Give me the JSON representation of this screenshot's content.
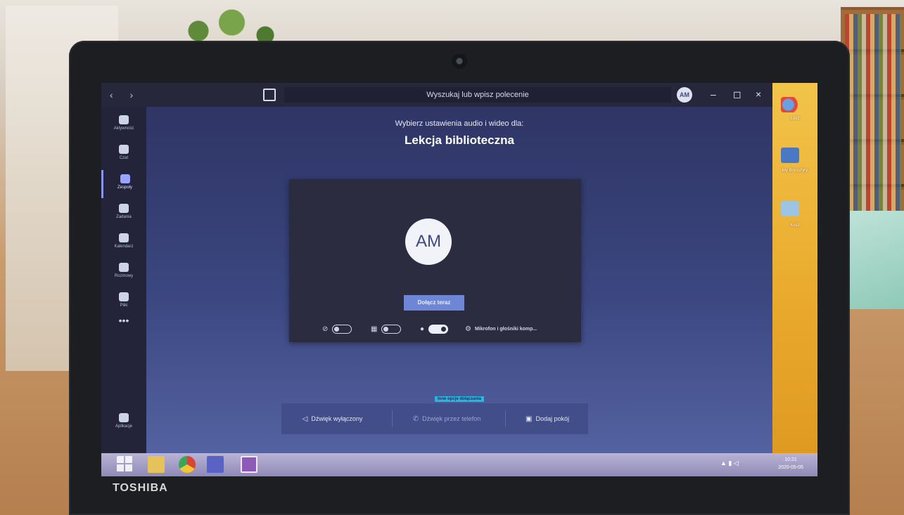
{
  "titlebar": {
    "nav_arrows": "‹ ›",
    "search_placeholder": "Wyszukaj lub wpisz polecenie",
    "user_initials": "AM",
    "minimize": "–",
    "maximize": "◻",
    "close": "×"
  },
  "rail": {
    "items": [
      {
        "label": "Aktywność",
        "icon": "bell-icon"
      },
      {
        "label": "Czat",
        "icon": "chat-icon"
      },
      {
        "label": "Zespoły",
        "icon": "teams-icon",
        "active": true
      },
      {
        "label": "Zadania",
        "icon": "assignments-icon"
      },
      {
        "label": "Kalendarz",
        "icon": "calendar-icon"
      },
      {
        "label": "Rozmowy",
        "icon": "phone-icon"
      },
      {
        "label": "Pliki",
        "icon": "file-icon"
      }
    ],
    "more": "•••",
    "apps_label": "Aplikacje",
    "help": "?"
  },
  "prejoin": {
    "subtitle": "Wybierz ustawienia audio i wideo dla:",
    "meeting_title": "Lekcja biblioteczna",
    "avatar_initials": "AM",
    "join_label": "Dołącz teraz",
    "audio_device_label": "Mikrofon i głośniki komp...",
    "camera_on": false,
    "blur_on": false,
    "mic_on": true
  },
  "other_join_options": {
    "heading": "Inne opcje dołączania",
    "sound_off": "Dźwięk wyłączony",
    "phone_audio": "Dźwięk przez telefon",
    "add_room": "Dodaj pokój"
  },
  "desktop": {
    "icons": [
      {
        "label": "Łódź"
      },
      {
        "label": "My Boroszyry"
      },
      {
        "label": "Kosz"
      }
    ]
  },
  "taskbar": {
    "clock_time": "10:21",
    "clock_date": "2020-05-05"
  },
  "device": {
    "brand": "TOSHIBA"
  },
  "colors": {
    "accent": "#6e86d6",
    "rail_bg": "#23243a",
    "stage_bg": "#3b4780",
    "highlight": "#2bb5d8"
  }
}
